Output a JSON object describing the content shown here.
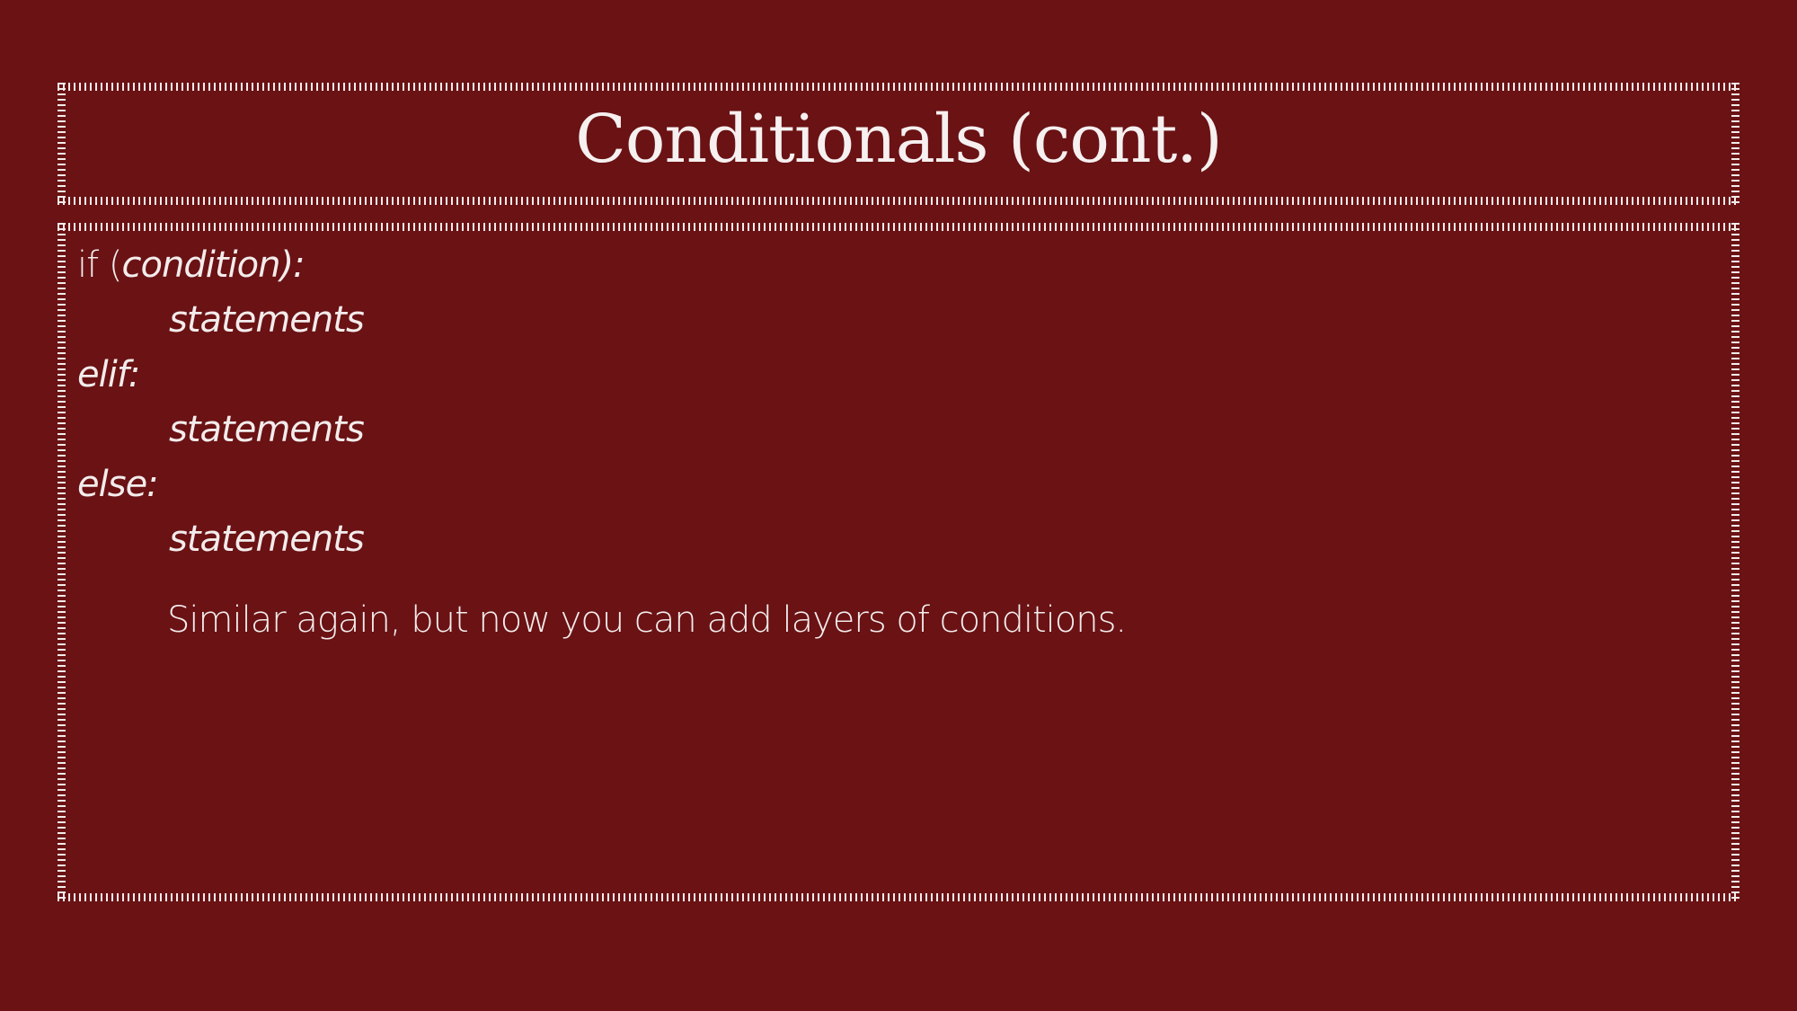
{
  "slide": {
    "title": "Conditionals (cont.)",
    "code": {
      "if_keyword": "if (",
      "if_condition": "condition",
      "if_close": "):",
      "statements_1": "statements",
      "elif_line": "elif:",
      "statements_2": "statements",
      "else_line": "else:",
      "statements_3": "statements"
    },
    "note": "Similar again, but now you can add layers of conditions."
  },
  "colors": {
    "background": "#6a1214",
    "text": "#f3ecec",
    "border": "#f3ecec"
  }
}
